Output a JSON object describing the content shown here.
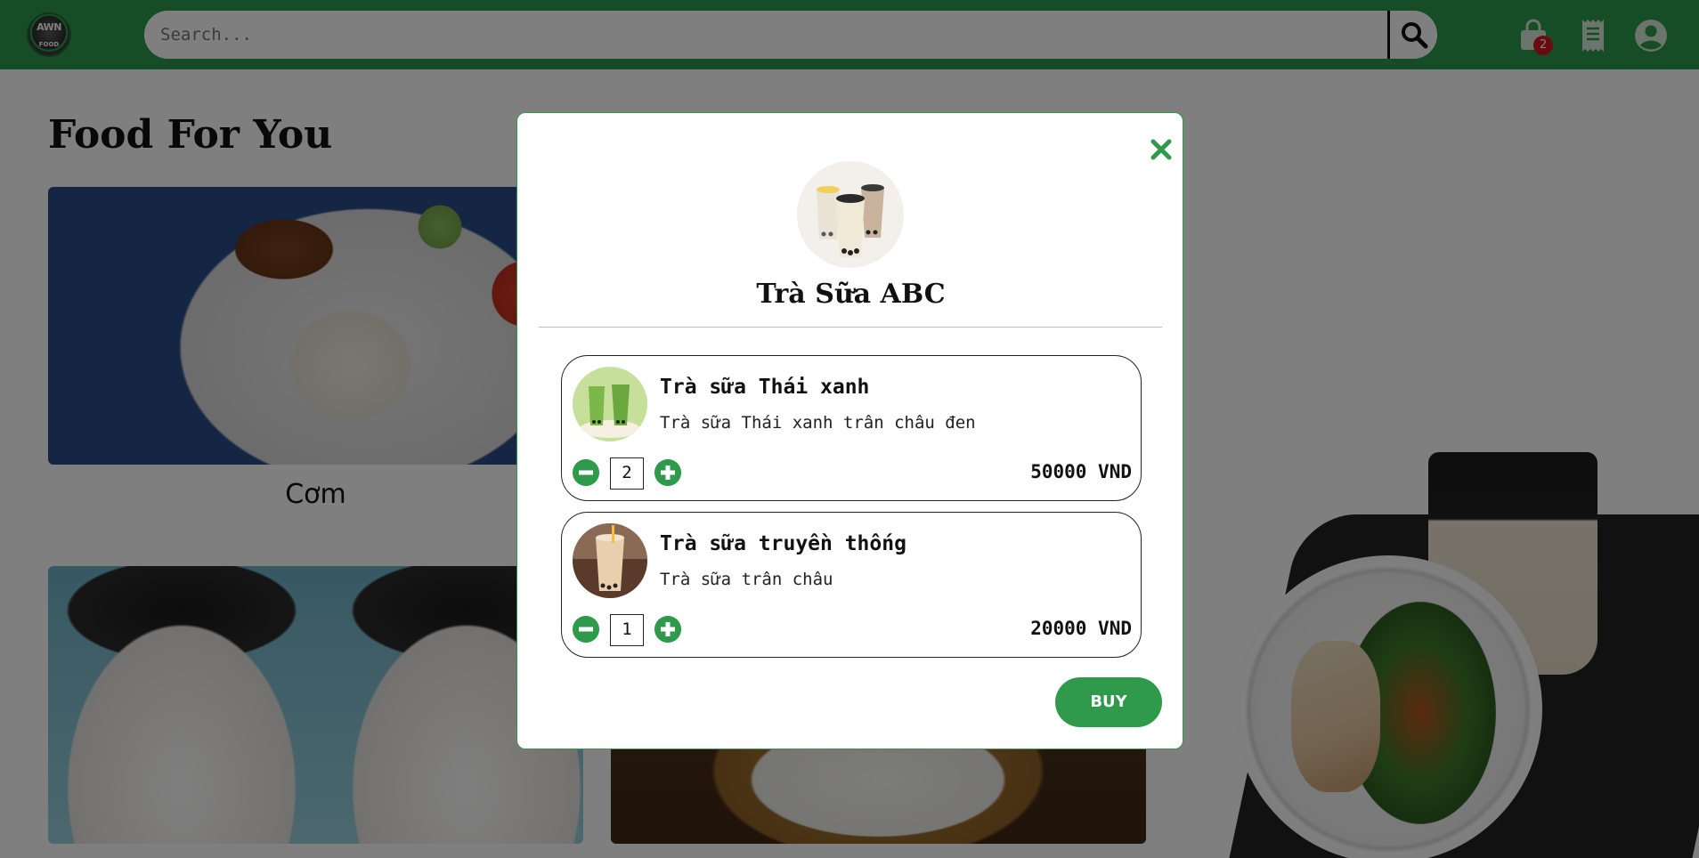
{
  "header": {
    "logo_text": "AWN",
    "logo_subtext": "FOOD",
    "search_placeholder": "Search...",
    "cart_count": "2",
    "icons": {
      "search": "search-icon",
      "cart": "shopping-bag-icon",
      "orders": "receipt-icon",
      "account": "user-circle-icon"
    }
  },
  "main": {
    "section_title": "Food For You",
    "cards": [
      {
        "label": "Cơm"
      }
    ]
  },
  "modal": {
    "shop_name": "Trà Sữa ABC",
    "items": [
      {
        "name": "Trà sữa Thái xanh",
        "description": "Trà sữa Thái xanh trân châu đen",
        "quantity": "2",
        "price": "50000 VND"
      },
      {
        "name": "Trà sữa truyền thống",
        "description": "Trà sữa trân châu",
        "quantity": "1",
        "price": "20000 VND"
      }
    ],
    "buy_label": "BUY"
  },
  "colors": {
    "brand_green": "#2f9a4c",
    "badge_red": "#d0161e",
    "overlay": "rgba(0,0,0,0.5)"
  }
}
